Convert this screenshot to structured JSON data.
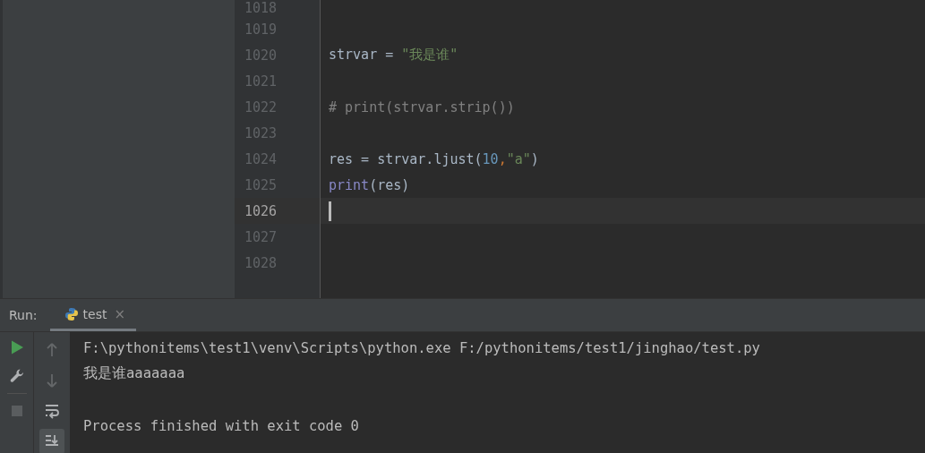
{
  "editor": {
    "lines": [
      {
        "number": "1018",
        "current": false
      },
      {
        "number": "1019",
        "current": false
      },
      {
        "number": "1020",
        "current": false,
        "tokens": [
          {
            "kind": "plain",
            "text": "strvar = "
          },
          {
            "kind": "string",
            "text": "\"我是谁\""
          }
        ]
      },
      {
        "number": "1021",
        "current": false
      },
      {
        "number": "1022",
        "current": false,
        "tokens": [
          {
            "kind": "comment",
            "text": "# print(strvar.strip())"
          }
        ]
      },
      {
        "number": "1023",
        "current": false
      },
      {
        "number": "1024",
        "current": false,
        "tokens": [
          {
            "kind": "plain",
            "text": "res = strvar.ljust("
          },
          {
            "kind": "number",
            "text": "10"
          },
          {
            "kind": "punct",
            "text": ","
          },
          {
            "kind": "string",
            "text": "\"a\""
          },
          {
            "kind": "plain",
            "text": ")"
          }
        ]
      },
      {
        "number": "1025",
        "current": false,
        "tokens": [
          {
            "kind": "builtin",
            "text": "print"
          },
          {
            "kind": "plain",
            "text": "(res)"
          }
        ]
      },
      {
        "number": "1026",
        "current": true
      },
      {
        "number": "1027",
        "current": false
      },
      {
        "number": "1028",
        "current": false
      }
    ]
  },
  "run_panel": {
    "label": "Run:",
    "tabs": [
      {
        "label": "test",
        "selected": true,
        "close": "×"
      }
    ],
    "toolbar_left": [
      {
        "kind": "play"
      },
      {
        "kind": "wrench"
      },
      {
        "kind": "stop"
      }
    ],
    "toolbar_right": [
      {
        "kind": "up",
        "disabled": true,
        "selected": false
      },
      {
        "kind": "down",
        "disabled": true,
        "selected": false
      },
      {
        "kind": "wrap",
        "disabled": false,
        "selected": false
      },
      {
        "kind": "scroll-end",
        "disabled": false,
        "selected": true
      }
    ],
    "console": {
      "lines": [
        "F:\\pythonitems\\test1\\venv\\Scripts\\python.exe F:/pythonitems/test1/jinghao/test.py",
        "我是谁aaaaaaa"
      ],
      "exit_message": "Process finished with exit code 0"
    }
  }
}
